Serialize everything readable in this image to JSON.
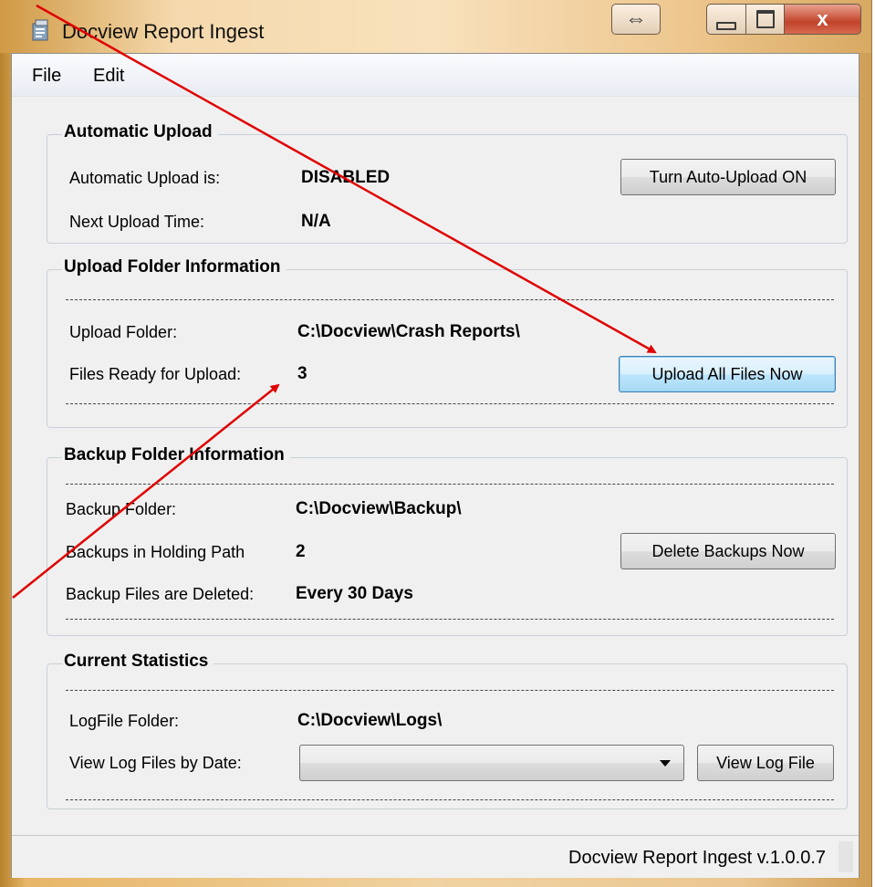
{
  "window": {
    "title": "Docview Report Ingest",
    "resize_arrows": "⇔",
    "close_glyph": "x"
  },
  "menu": {
    "items": [
      "File",
      "Edit"
    ]
  },
  "automatic_upload": {
    "title": "Automatic Upload",
    "status_label": "Automatic Upload is:",
    "status_value": "DISABLED",
    "next_label": "Next Upload Time:",
    "next_value": "N/A",
    "toggle_button": "Turn Auto-Upload ON"
  },
  "upload_folder": {
    "title": "Upload Folder Information",
    "folder_label": "Upload Folder:",
    "folder_value": "C:\\Docview\\Crash Reports\\",
    "files_label": "Files Ready for Upload:",
    "files_value": "3",
    "upload_button": "Upload All Files Now"
  },
  "backup_folder": {
    "title": "Backup Folder Information",
    "folder_label": "Backup Folder:",
    "folder_value": "C:\\Docview\\Backup\\",
    "holding_label": "Backups in Holding Path",
    "holding_value": "2",
    "deleted_label": "Backup Files are Deleted:",
    "deleted_value": "Every 30 Days",
    "delete_button": "Delete Backups Now"
  },
  "statistics": {
    "title": "Current Statistics",
    "log_label": "LogFile Folder:",
    "log_value": "C:\\Docview\\Logs\\",
    "date_label": "View Log Files by Date:",
    "date_selected": "",
    "view_button": "View Log File"
  },
  "status_bar": {
    "text": "Docview Report Ingest v.1.0.0.7"
  },
  "annotation_color": "#e00000"
}
